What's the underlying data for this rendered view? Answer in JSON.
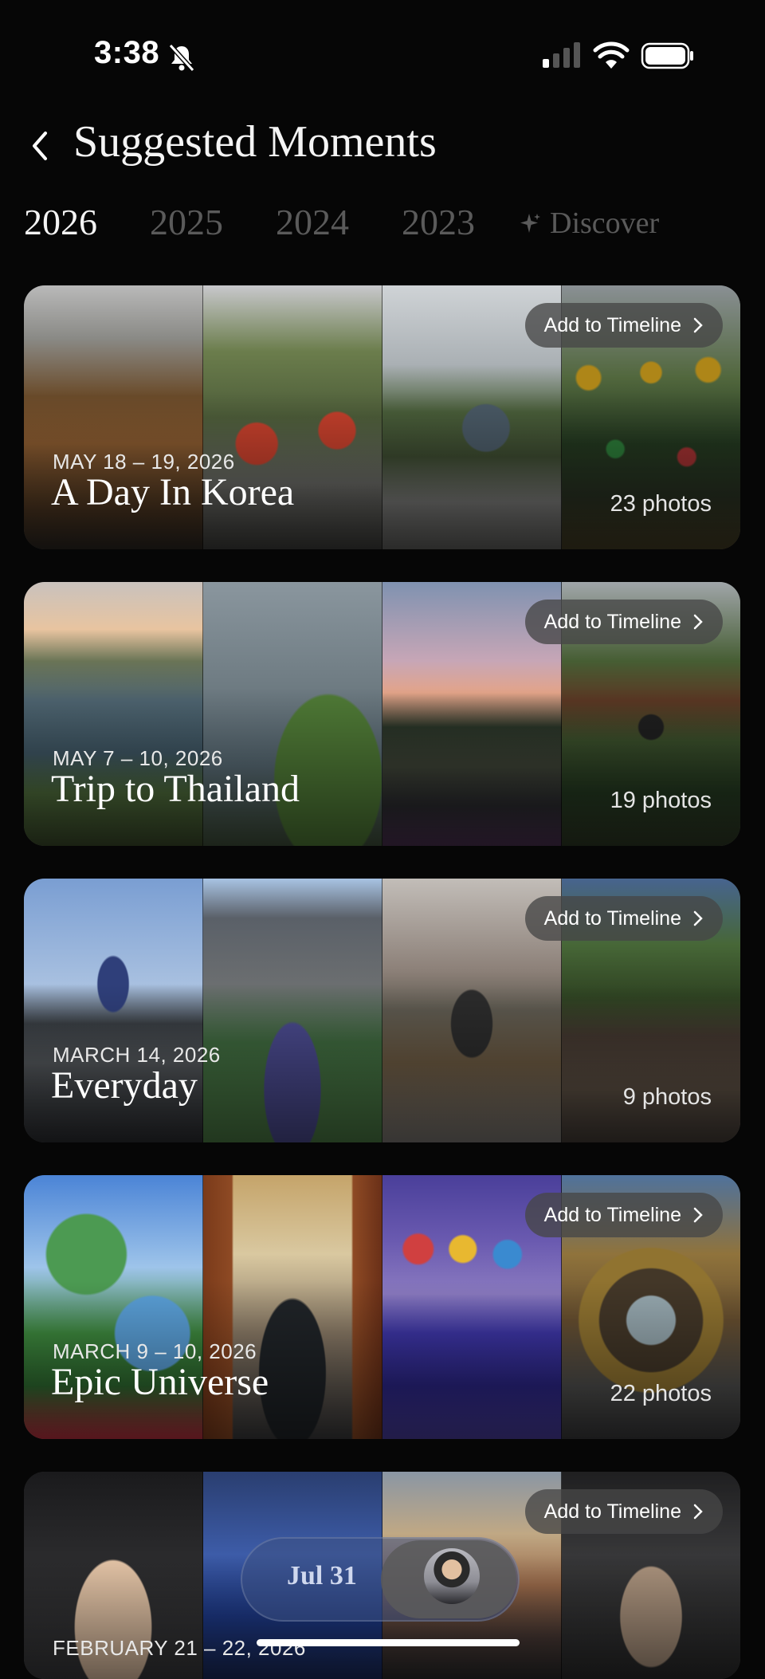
{
  "status_bar": {
    "time": "3:38"
  },
  "header": {
    "title": "Suggested Moments"
  },
  "tabs": [
    {
      "label": "2026",
      "active": true
    },
    {
      "label": "2025",
      "active": false
    },
    {
      "label": "2024",
      "active": false
    },
    {
      "label": "2023",
      "active": false
    },
    {
      "label": "Discover",
      "active": false
    }
  ],
  "add_label": "Add to Timeline",
  "moments": [
    {
      "date": "MAY 18 – 19, 2026",
      "title": "A Day In Korea",
      "count": "23 photos"
    },
    {
      "date": "MAY 7 – 10, 2026",
      "title": "Trip to Thailand",
      "count": "19 photos"
    },
    {
      "date": "MARCH 14, 2026",
      "title": "Everyday",
      "count": "9 photos"
    },
    {
      "date": "MARCH 9 – 10, 2026",
      "title": "Epic Universe",
      "count": "22 photos"
    },
    {
      "date": "FEBRUARY 21 – 22, 2026",
      "title": "",
      "count": ""
    }
  ],
  "scrubber": {
    "date": "Jul 31"
  },
  "colors": {
    "background": "#060606",
    "inactive_tab": "#5a5a5a",
    "pill": "#464646"
  },
  "icons": [
    "back-chevron-icon",
    "bell-slash-icon",
    "signal-icon",
    "wifi-icon",
    "battery-icon",
    "sparkle-icon",
    "chevron-right-icon"
  ]
}
